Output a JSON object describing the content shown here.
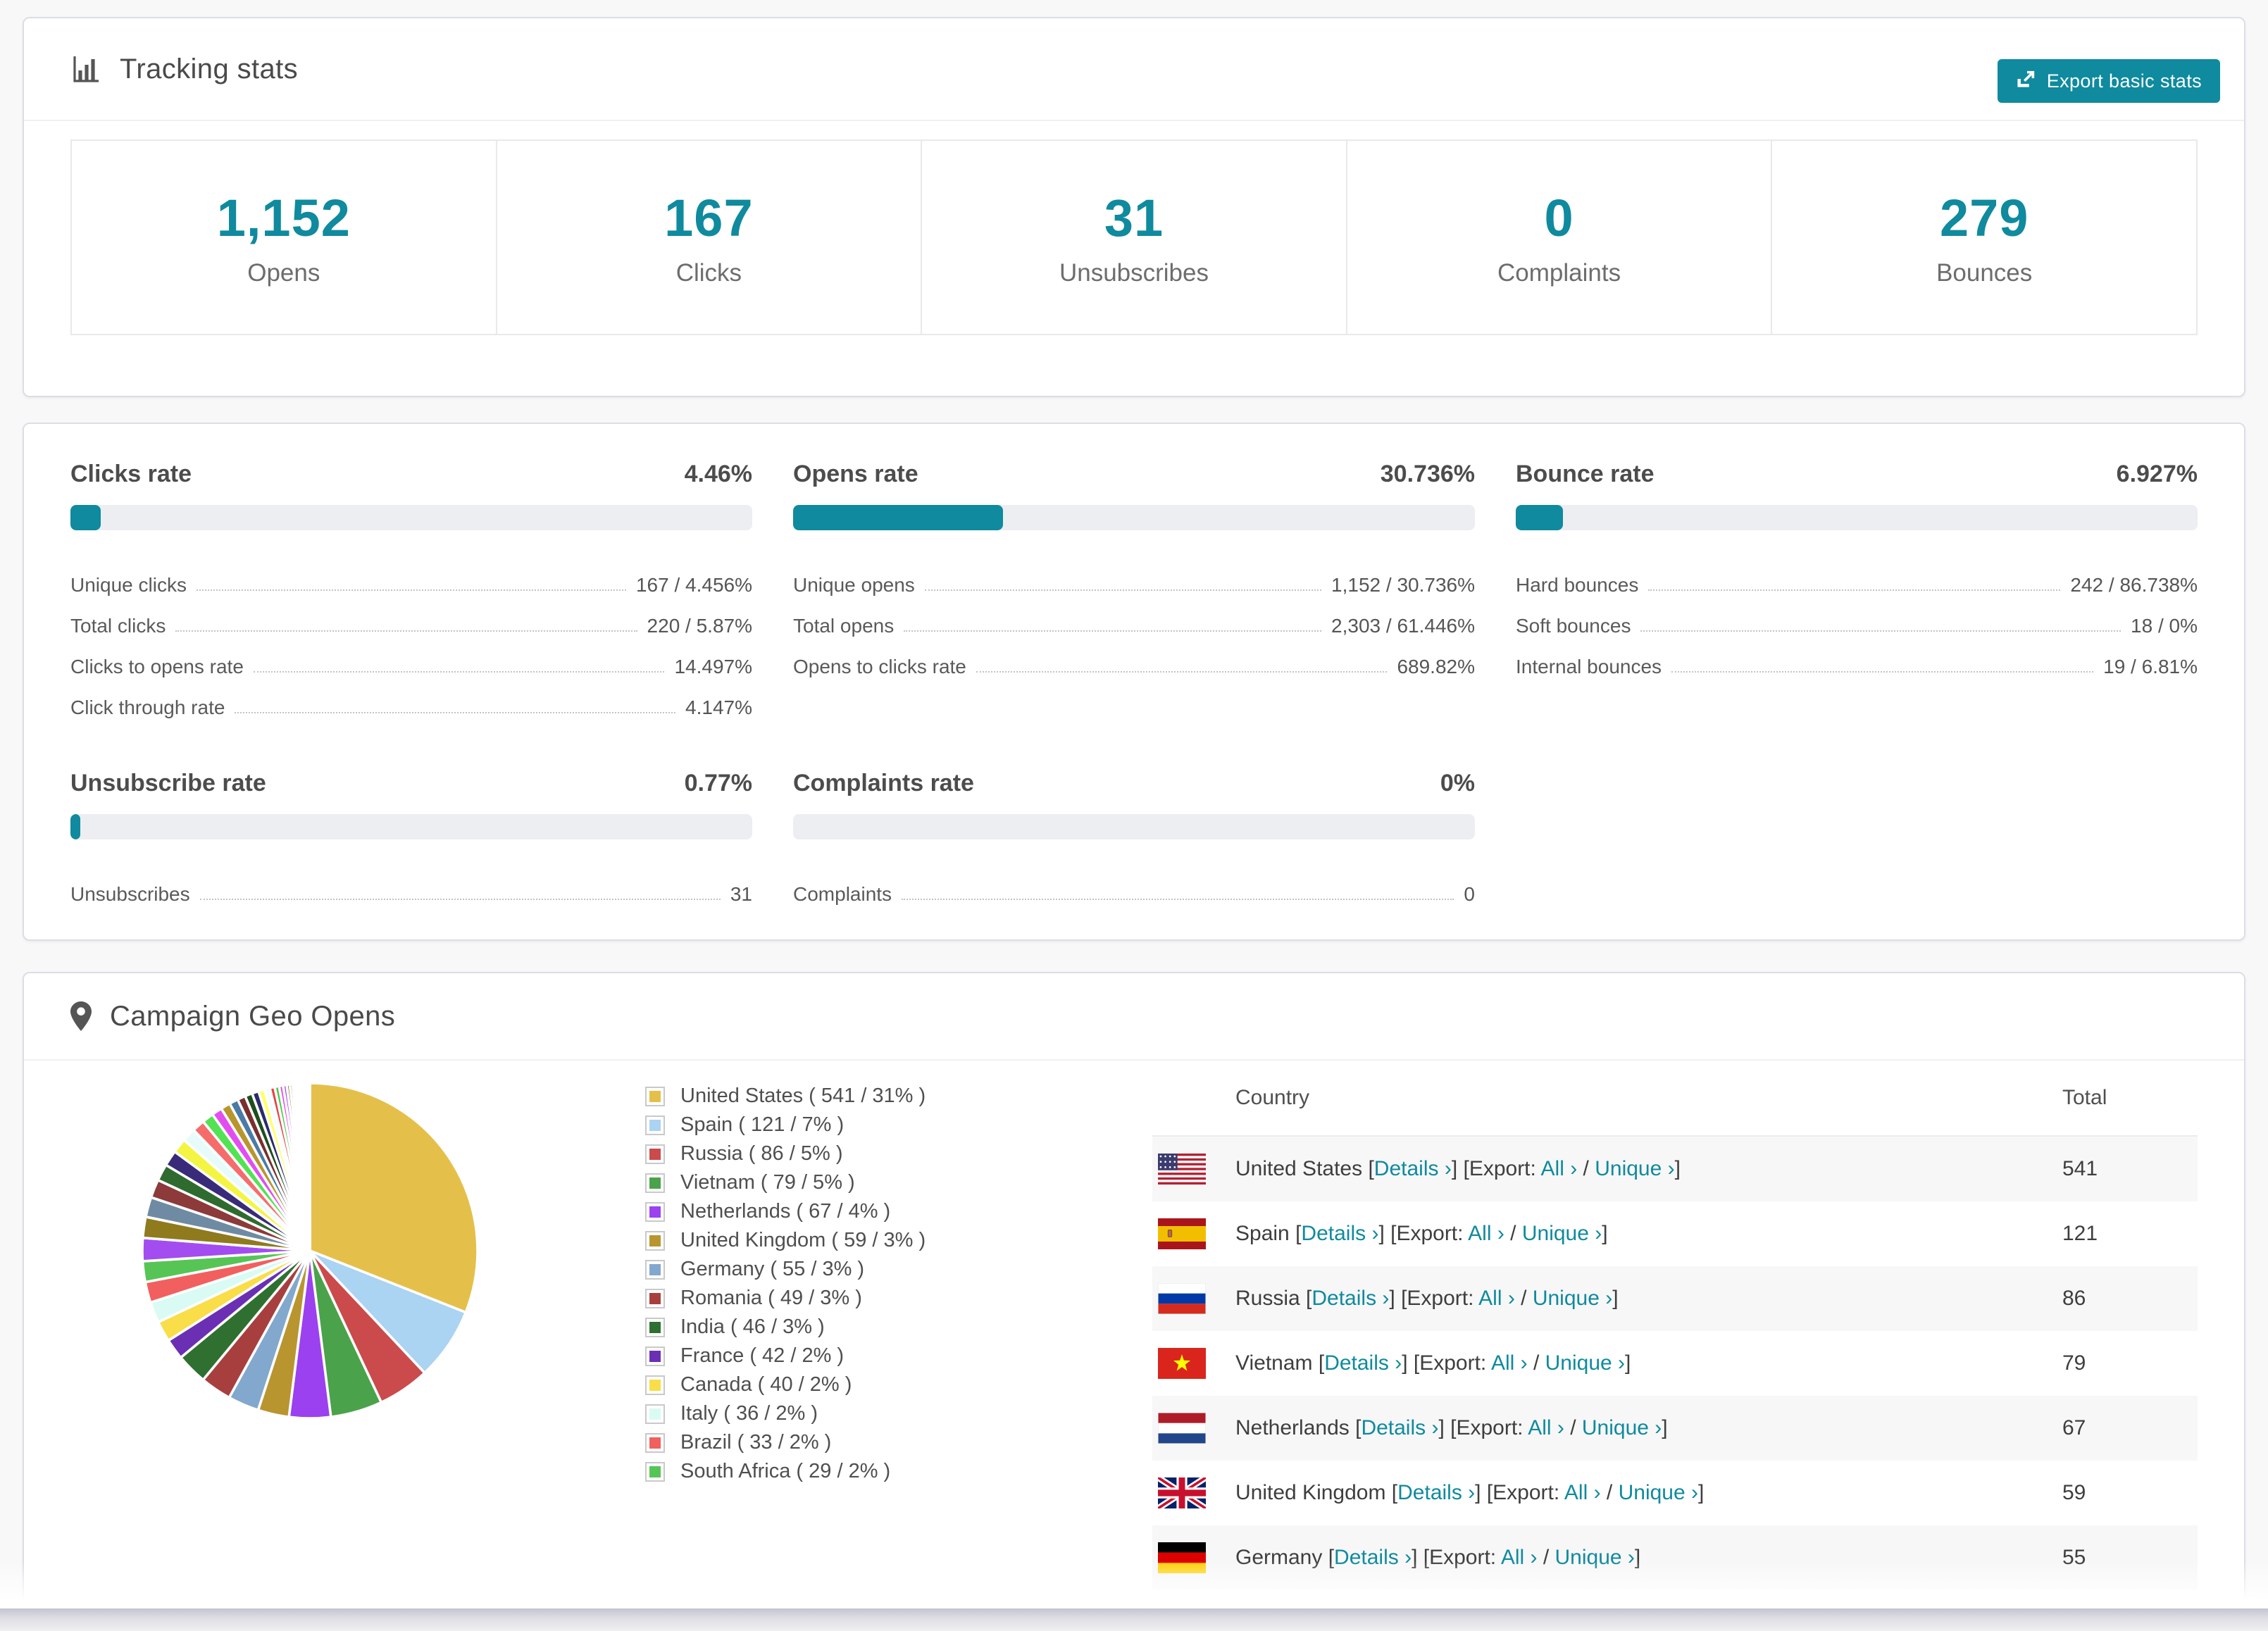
{
  "accent": "#0f8a9e",
  "tracking": {
    "title": "Tracking stats",
    "export_button": "Export basic stats",
    "stats": [
      {
        "value": "1,152",
        "label": "Opens"
      },
      {
        "value": "167",
        "label": "Clicks"
      },
      {
        "value": "31",
        "label": "Unsubscribes"
      },
      {
        "value": "0",
        "label": "Complaints"
      },
      {
        "value": "279",
        "label": "Bounces"
      }
    ]
  },
  "rates": {
    "blocks": [
      {
        "title": "Clicks rate",
        "value": "4.46%",
        "bar_pct": 4.46,
        "rows": [
          [
            "Unique clicks",
            "167 / 4.456%"
          ],
          [
            "Total clicks",
            "220 / 5.87%"
          ],
          [
            "Clicks to opens rate",
            "14.497%"
          ],
          [
            "Click through rate",
            "4.147%"
          ]
        ]
      },
      {
        "title": "Opens rate",
        "value": "30.736%",
        "bar_pct": 30.736,
        "rows": [
          [
            "Unique opens",
            "1,152 / 30.736%"
          ],
          [
            "Total opens",
            "2,303 / 61.446%"
          ],
          [
            "Opens to clicks rate",
            "689.82%"
          ]
        ]
      },
      {
        "title": "Bounce rate",
        "value": "6.927%",
        "bar_pct": 6.927,
        "rows": [
          [
            "Hard bounces",
            "242 / 86.738%"
          ],
          [
            "Soft bounces",
            "18 / 0%"
          ],
          [
            "Internal bounces",
            "19 / 6.81%"
          ]
        ]
      },
      {
        "title": "Unsubscribe rate",
        "value": "0.77%",
        "bar_pct": 0.77,
        "rows": [
          [
            "Unsubscribes",
            "31"
          ]
        ]
      },
      {
        "title": "Complaints rate",
        "value": "0%",
        "bar_pct": 0,
        "rows": [
          [
            "Complaints",
            "0"
          ]
        ]
      }
    ]
  },
  "geo": {
    "title": "Campaign Geo Opens",
    "table": {
      "headers": [
        "Country",
        "Total"
      ],
      "link_labels": {
        "details": "Details ›",
        "export": "Export:",
        "all": "All ›",
        "unique": "Unique ›"
      },
      "rows": [
        {
          "country": "United States",
          "flag": "us",
          "total": "541"
        },
        {
          "country": "Spain",
          "flag": "es",
          "total": "121"
        },
        {
          "country": "Russia",
          "flag": "ru",
          "total": "86"
        },
        {
          "country": "Vietnam",
          "flag": "vn",
          "total": "79"
        },
        {
          "country": "Netherlands",
          "flag": "nl",
          "total": "67"
        },
        {
          "country": "United Kingdom",
          "flag": "gb",
          "total": "59"
        },
        {
          "country": "Germany",
          "flag": "de",
          "total": "55",
          "partial": true
        }
      ]
    }
  },
  "chart_data": {
    "type": "pie",
    "title": "Campaign Geo Opens",
    "legend_position": "right",
    "start_angle_deg": -90,
    "direction": "clockwise",
    "slices": [
      {
        "label": "United States",
        "value": 541,
        "pct": 31,
        "color": "#e4c04b"
      },
      {
        "label": "Spain",
        "value": 121,
        "pct": 7,
        "color": "#abd3f2"
      },
      {
        "label": "Russia",
        "value": 86,
        "pct": 5,
        "color": "#cb4a4c"
      },
      {
        "label": "Vietnam",
        "value": 79,
        "pct": 5,
        "color": "#4aa34a"
      },
      {
        "label": "Netherlands",
        "value": 67,
        "pct": 4,
        "color": "#9b41ef"
      },
      {
        "label": "United Kingdom",
        "value": 59,
        "pct": 3,
        "color": "#b8952f"
      },
      {
        "label": "Germany",
        "value": 55,
        "pct": 3,
        "color": "#82a8cd"
      },
      {
        "label": "Romania",
        "value": 49,
        "pct": 3,
        "color": "#a83f3f"
      },
      {
        "label": "India",
        "value": 46,
        "pct": 3,
        "color": "#2f7030"
      },
      {
        "label": "France",
        "value": 42,
        "pct": 2,
        "color": "#6b2fb3"
      },
      {
        "label": "Canada",
        "value": 40,
        "pct": 2,
        "color": "#f9dd49"
      },
      {
        "label": "Italy",
        "value": 36,
        "pct": 2,
        "color": "#d9fbf4"
      },
      {
        "label": "Brazil",
        "value": 33,
        "pct": 2,
        "color": "#f25f5f"
      },
      {
        "label": "South Africa",
        "value": 29,
        "pct": 2,
        "color": "#56c556"
      }
    ],
    "others": {
      "note": "remaining ~26% made of many small unlabeled country slices",
      "weights": [
        2.2,
        2.0,
        1.9,
        1.75,
        1.6,
        1.5,
        1.4,
        1.3,
        1.2,
        1.1,
        1.0,
        0.92,
        0.84,
        0.77,
        0.7,
        0.64,
        0.58,
        0.52,
        0.47,
        0.42,
        0.38,
        0.34,
        0.3,
        0.27,
        0.24,
        0.21,
        0.18,
        0.16,
        0.14,
        0.12,
        0.1,
        0.09,
        0.08,
        0.07,
        0.06,
        0.05,
        0.04,
        0.035,
        0.03,
        0.025
      ],
      "colors": [
        "#a34df0",
        "#8f7a1e",
        "#6f8ba3",
        "#8c3a3a",
        "#2f6b2f",
        "#3a2a7a",
        "#f4f442",
        "#e8fbfb",
        "#f56c6c",
        "#53e253",
        "#e24df0",
        "#b8962e",
        "#4a7ba6",
        "#7a2e2e",
        "#1e4d1e",
        "#2a2a6e",
        "#ffff66",
        "#f2fdfd",
        "#e64444",
        "#44cc44",
        "#ee44ee"
      ]
    }
  }
}
